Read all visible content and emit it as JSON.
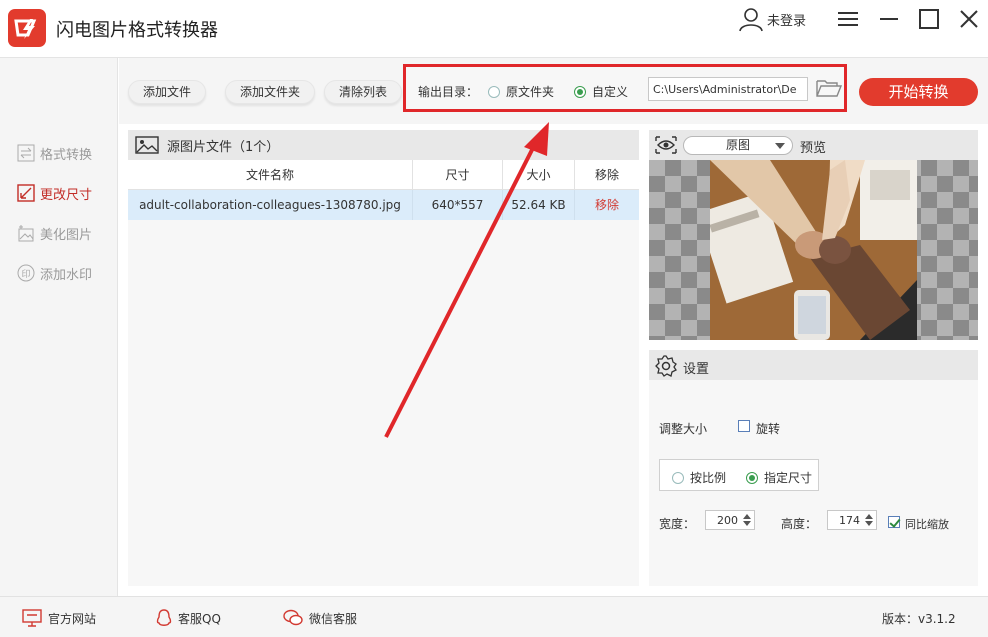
{
  "app": {
    "title": "闪电图片格式转换器",
    "login_label": "未登录"
  },
  "sidebar": {
    "items": [
      {
        "label": "格式转换",
        "icon": "swap-icon",
        "active": false
      },
      {
        "label": "更改尺寸",
        "icon": "resize-icon",
        "active": true
      },
      {
        "label": "美化图片",
        "icon": "beautify-icon",
        "active": false
      },
      {
        "label": "添加水印",
        "icon": "watermark-icon",
        "active": false
      }
    ]
  },
  "toolbar": {
    "add_file": "添加文件",
    "add_folder": "添加文件夹",
    "clear_list": "清除列表",
    "output_label": "输出目录：",
    "option_original": "原文件夹",
    "option_custom": "自定义",
    "selected_option": "自定义",
    "output_path": "C:\\Users\\Administrator\\De",
    "start_button": "开始转换"
  },
  "file_list": {
    "header": "源图片文件（1个）",
    "columns": [
      "文件名称",
      "尺寸",
      "大小",
      "移除"
    ],
    "rows": [
      {
        "name": "adult-collaboration-colleagues-1308780.jpg",
        "size": "640*557",
        "filesize": "52.64 KB",
        "remove": "移除"
      }
    ]
  },
  "preview": {
    "select_value": "原图",
    "label": "预览"
  },
  "settings": {
    "title": "设置",
    "resize_label": "调整大小",
    "rotate_label": "旋转",
    "rotate_checked": false,
    "by_ratio": "按比例",
    "by_size": "指定尺寸",
    "selected_mode": "指定尺寸",
    "width_label": "宽度：",
    "width_value": "200",
    "height_label": "高度：",
    "height_value": "174",
    "keep_ratio_label": "同比缩放",
    "keep_ratio_checked": true
  },
  "statusbar": {
    "website": "官方网站",
    "qq": "客服QQ",
    "wechat": "微信客服",
    "version": "版本：v3.1.2"
  },
  "colors": {
    "brand_red": "#e23b2d",
    "highlight_red": "#e0272a",
    "radio_green": "#3a9d4f"
  }
}
